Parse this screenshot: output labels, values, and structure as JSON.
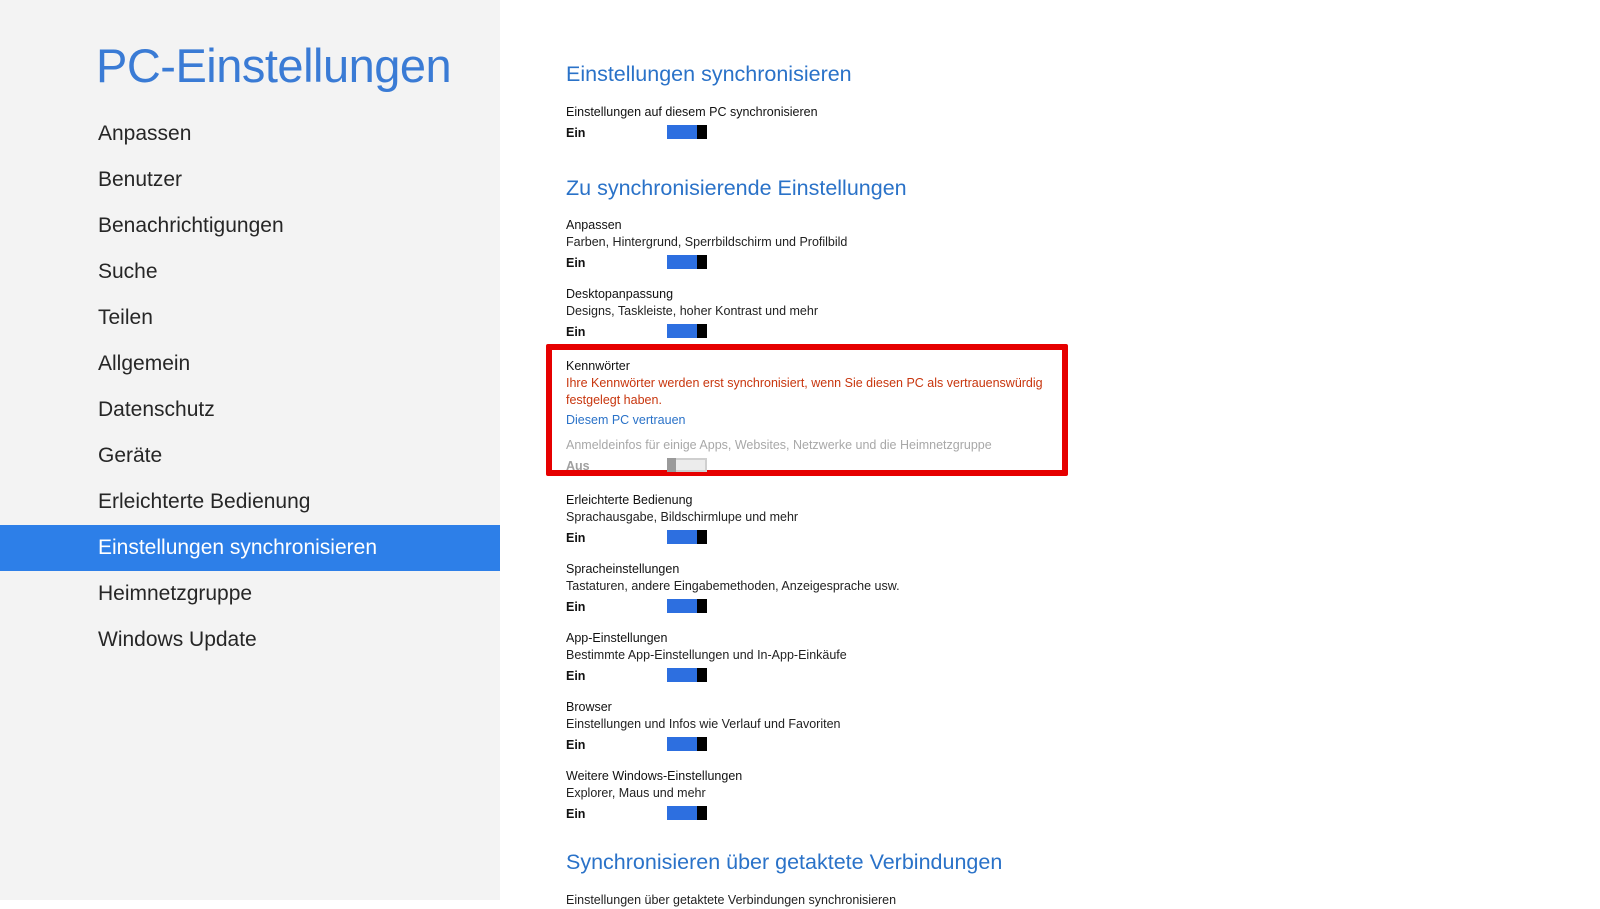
{
  "sidebar": {
    "title": "PC-Einstellungen",
    "items": [
      {
        "label": "Anpassen"
      },
      {
        "label": "Benutzer"
      },
      {
        "label": "Benachrichtigungen"
      },
      {
        "label": "Suche"
      },
      {
        "label": "Teilen"
      },
      {
        "label": "Allgemein"
      },
      {
        "label": "Datenschutz"
      },
      {
        "label": "Geräte"
      },
      {
        "label": "Erleichterte Bedienung"
      },
      {
        "label": "Einstellungen synchronisieren",
        "selected": true
      },
      {
        "label": "Heimnetzgruppe"
      },
      {
        "label": "Windows Update"
      }
    ]
  },
  "main": {
    "section1": {
      "title": "Einstellungen synchronisieren",
      "setting": {
        "name": "Einstellungen auf diesem PC synchronisieren",
        "state": "Ein",
        "on": true
      }
    },
    "section2": {
      "title": "Zu synchronisierende Einstellungen",
      "settings": [
        {
          "name": "Anpassen",
          "desc": "Farben, Hintergrund, Sperrbildschirm und Profilbild",
          "state": "Ein",
          "on": true
        },
        {
          "name": "Desktopanpassung",
          "desc": "Designs, Taskleiste, hoher Kontrast und mehr",
          "state": "Ein",
          "on": true
        },
        {
          "name": "Erleichterte Bedienung",
          "desc": "Sprachausgabe, Bildschirmlupe und mehr",
          "state": "Ein",
          "on": true
        },
        {
          "name": "Spracheinstellungen",
          "desc": "Tastaturen, andere Eingabemethoden, Anzeigesprache usw.",
          "state": "Ein",
          "on": true
        },
        {
          "name": "App-Einstellungen",
          "desc": "Bestimmte App-Einstellungen und In-App-Einkäufe",
          "state": "Ein",
          "on": true
        },
        {
          "name": "Browser",
          "desc": "Einstellungen und Infos wie Verlauf und Favoriten",
          "state": "Ein",
          "on": true
        },
        {
          "name": "Weitere Windows-Einstellungen",
          "desc": "Explorer, Maus und mehr",
          "state": "Ein",
          "on": true
        }
      ],
      "passwords": {
        "name": "Kennwörter",
        "warning": "Ihre Kennwörter werden erst synchronisiert, wenn Sie diesen PC als vertrauenswürdig festgelegt haben.",
        "link": "Diesem PC vertrauen",
        "desc": "Anmeldeinfos für einige Apps, Websites, Netzwerke und die Heimnetzgruppe",
        "state": "Aus",
        "on": false,
        "highlight_color": "#e60000"
      }
    },
    "section3": {
      "title": "Synchronisieren über getaktete Verbindungen",
      "partial_text": "Einstellungen über getaktete Verbindungen synchronisieren"
    }
  },
  "colors": {
    "accent": "#2d7fe8",
    "title_blue": "#2a72c8",
    "warning": "#c8360e"
  }
}
